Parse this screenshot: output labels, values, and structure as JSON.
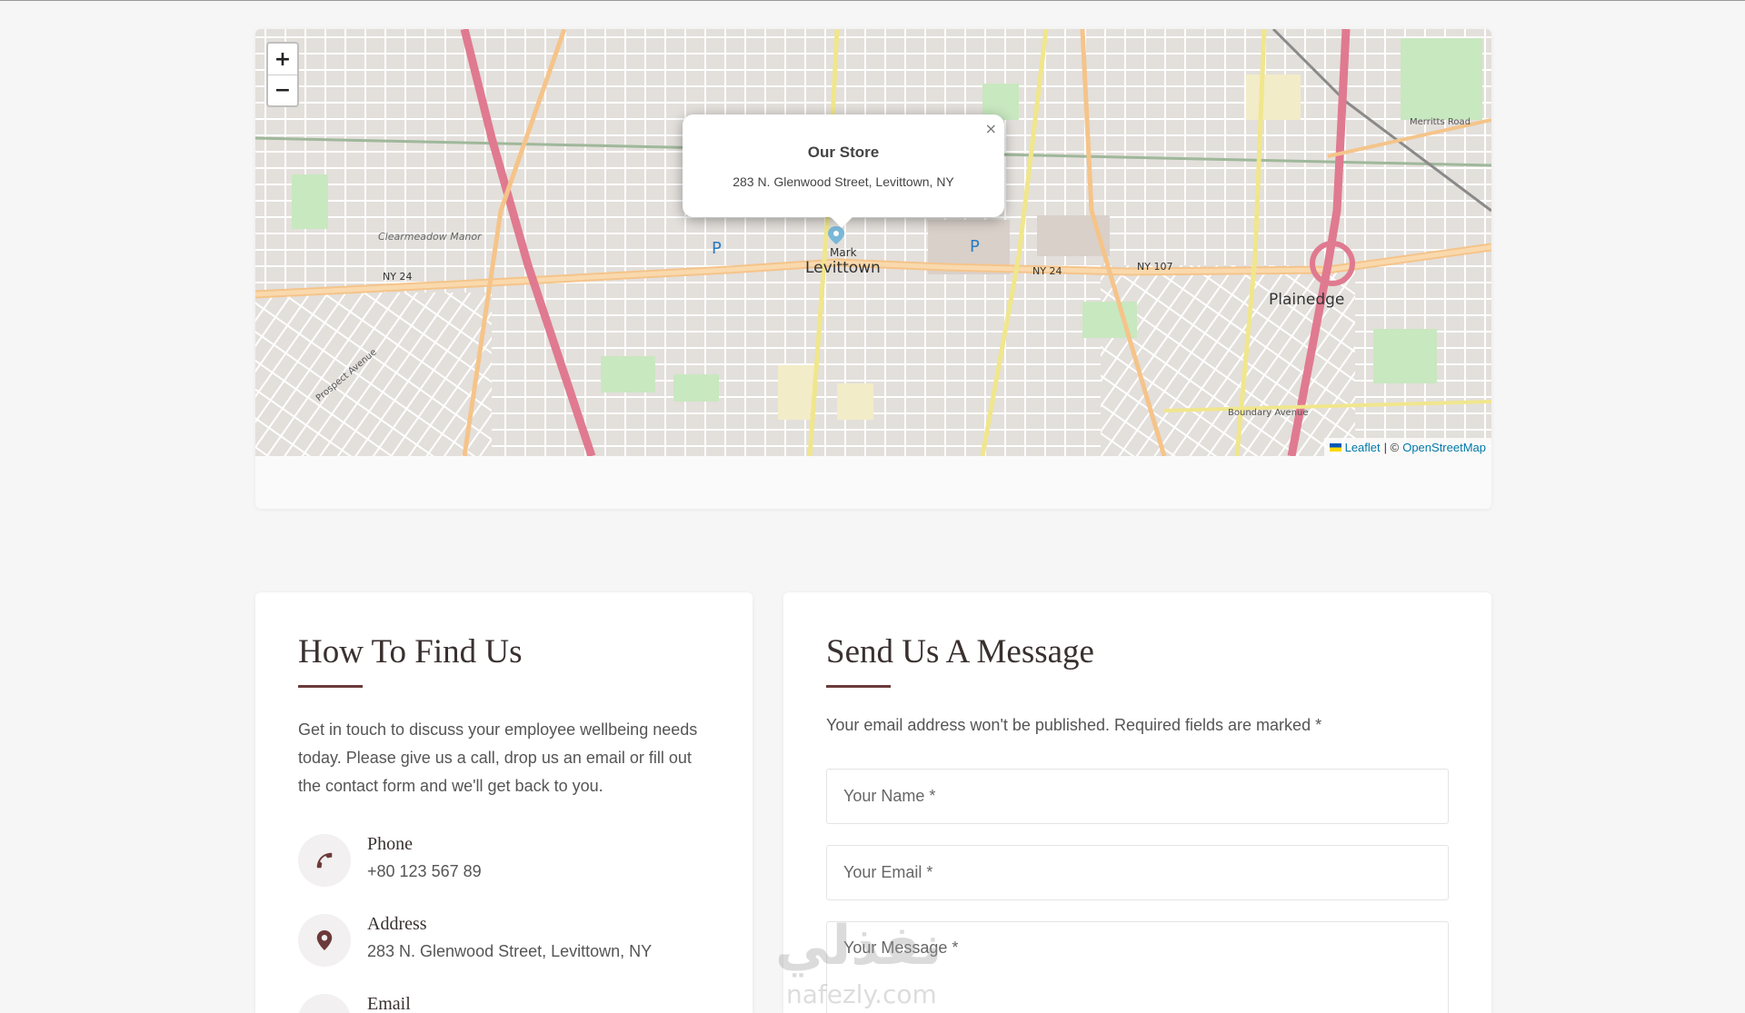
{
  "map": {
    "zoom_in_label": "+",
    "zoom_out_label": "−",
    "popup": {
      "close_label": "×",
      "title": "Our Store",
      "address": "283 N. Glenwood Street, Levittown, NY"
    },
    "labels": {
      "levittown": "Levittown",
      "plainedge": "Plainedge",
      "ny24_a": "NY 24",
      "ny24_b": "NY 24",
      "ny107": "NY 107",
      "clearmeadow": "Clearmeadow Manor",
      "boundary": "Boundary Avenue",
      "merritts": "Merritts Road",
      "prospect": "Prospect Avenue",
      "marker_label": "Mark"
    },
    "attribution": {
      "leaflet": "Leaflet",
      "separator": "| ©",
      "osm": "OpenStreetMap"
    }
  },
  "find_us": {
    "title": "How To Find Us",
    "intro": "Get in touch to discuss your employee wellbeing needs today. Please give us a call, drop us an email or fill out the contact form and we'll get back to you.",
    "phone_label": "Phone",
    "phone_value": "+80 123 567 89",
    "address_label": "Address",
    "address_value": "283 N. Glenwood Street, Levittown, NY",
    "email_label": "Email"
  },
  "message": {
    "title": "Send Us A Message",
    "note": "Your email address won't be published. Required fields are marked *",
    "name_placeholder": "Your Name *",
    "email_placeholder": "Your Email *",
    "message_placeholder": "Your Message *"
  },
  "watermark": {
    "arabic": "نفذلي",
    "latin": "nafezly.com"
  },
  "colors": {
    "accent": "#6b3a3a",
    "link": "#0078a8",
    "background": "#f7f6f6"
  }
}
